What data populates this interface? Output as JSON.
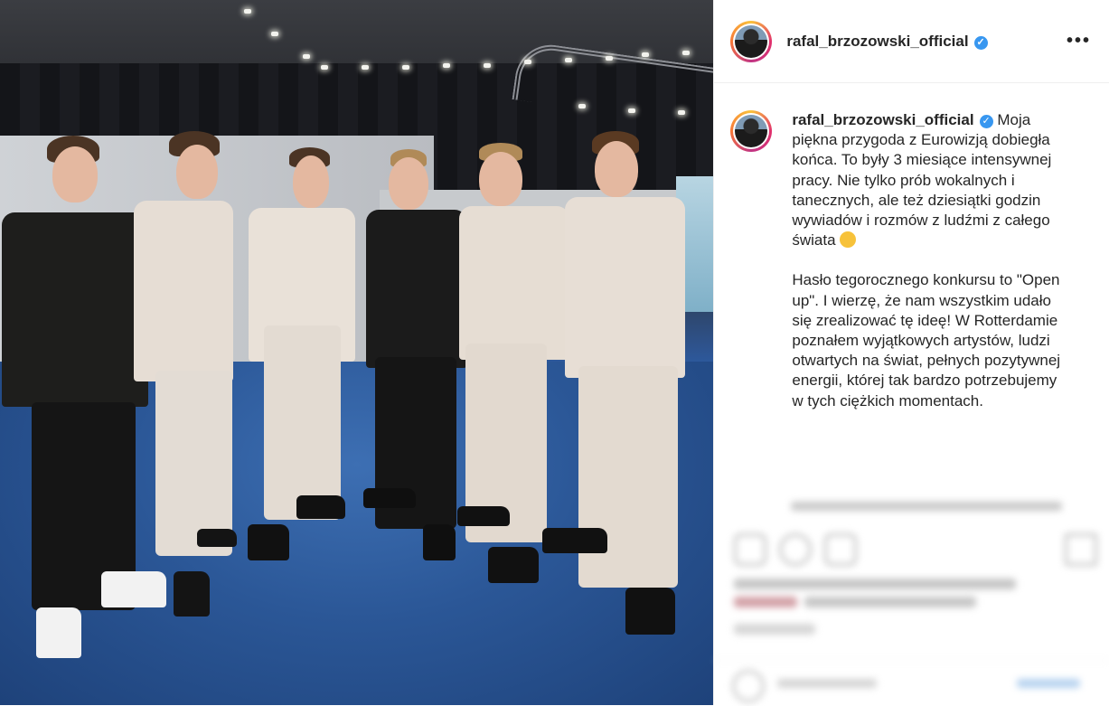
{
  "photo": {
    "icon": "eurovision-group-photo"
  },
  "post": {
    "username": "rafal_brzozowski_official",
    "verified_icon": "verified-badge-icon",
    "more_icon": "more-options-icon",
    "more_label": "•••",
    "caption_username": "rafal_brzozowski_official",
    "caption_p1": "Moja piękna przygoda z Eurowizją dobiegła końca. To były 3 miesiące intensywnej pracy. Nie tylko prób wokalnych i tanecznych, ale też dziesiątki godzin wywiadów i rozmów z ludźmi z całego świata",
    "caption_p2": "Hasło tegorocznego konkursu to \"Open up\". I wierzę, że nam wszystkim udało się zrealizować tę ideę! W Rotterdamie poznałem wyjątkowych artystów, ludzi otwartych na świat, pełnych pozytywnej energii, której tak bardzo potrzebujemy w tych ciężkich momentach.",
    "emoji_icon": "face-screaming-emoji-icon"
  },
  "colors": {
    "verified": "#3897f0",
    "text": "#262626",
    "divider": "#efefef"
  }
}
